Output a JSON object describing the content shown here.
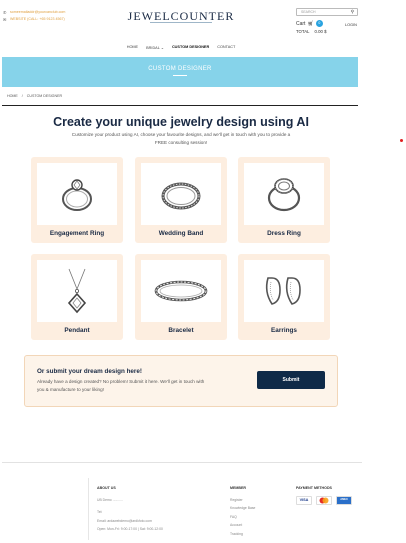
{
  "header": {
    "email": "someemailaddr@yourcanclub.com",
    "phone": "WEBSITE (CALL: +65 9123 4567)",
    "brand": "JEWELCOUNTER",
    "search_placeholder": "SEARCH",
    "cart_label": "Cart",
    "cart_count": "0",
    "login": "LOGIN",
    "total_label": "TOTAL",
    "total_value": "0.00",
    "total_currency": "$"
  },
  "nav": {
    "items": [
      "HOME",
      "BRIDAL",
      "CUSTOM DESIGNER",
      "CONTACT"
    ],
    "dropdown_marker": "⌄"
  },
  "banner": {
    "title": "CUSTOM DESIGNER"
  },
  "breadcrumb": {
    "home": "HOME",
    "separator": "/",
    "current": "CUSTOM DESIGNER"
  },
  "main": {
    "title": "Create your unique jewelry design using AI",
    "subtitle_line1": "Customize your product using AI, choose your favourite designs, and we'll get in touch with you to provide a",
    "subtitle_line2": "FREE consulting session!"
  },
  "categories": [
    {
      "label": "Engagement Ring",
      "icon": "engagement-ring-icon"
    },
    {
      "label": "Wedding Band",
      "icon": "wedding-band-icon"
    },
    {
      "label": "Dress Ring",
      "icon": "dress-ring-icon"
    },
    {
      "label": "Pendant",
      "icon": "pendant-icon"
    },
    {
      "label": "Bracelet",
      "icon": "bracelet-icon"
    },
    {
      "label": "Earrings",
      "icon": "earrings-icon"
    }
  ],
  "submit": {
    "title": "Or submit your dream design here!",
    "text_line1": "Already have a design created? No problem! Submit it here. We'll get in touch with",
    "text_line2": "you & manufacture to your liking!",
    "button": "Submit"
  },
  "footer": {
    "about_title": "ABOUT US",
    "about_lines": [
      "UB Demo ...........",
      "",
      "Tel:",
      "Email: ardawebdemo@ardkfoto.com",
      "Open: Mon-Fri: 9:00-17:00 | Sat: 9:00-12:00"
    ],
    "member_title": "MEMBER",
    "member_lines": [
      "Register",
      "Knowledge Base",
      "FAQ",
      "Account",
      "Tracking"
    ],
    "payment_title": "PAYMENT METHODS",
    "payment_cards": [
      "VISA",
      "MC",
      "AMEX"
    ]
  },
  "colors": {
    "brand_navy": "#1a2a44",
    "banner_blue": "#86d3ea",
    "card_peach": "#fdeee0",
    "accent_orange": "#e0a040",
    "button_navy": "#0f2a48",
    "cart_badge": "#29a3e0"
  }
}
